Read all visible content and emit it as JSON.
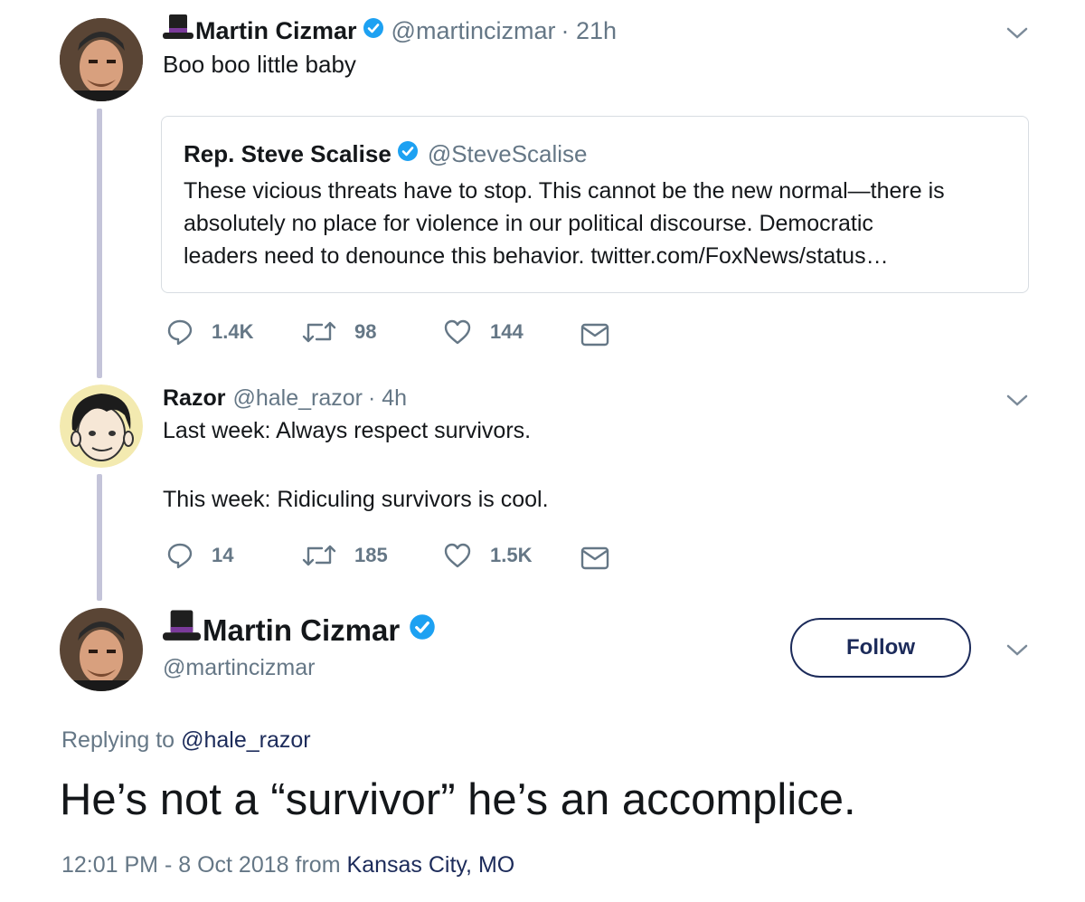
{
  "tweet1": {
    "name": "Martin Cizmar",
    "handle": "@martincizmar",
    "time": "· 21h",
    "text": "Boo boo little baby",
    "quote": {
      "name": "Rep. Steve Scalise",
      "handle": "@SteveScalise",
      "lines": [
        "These vicious threats have to stop. This cannot be the new normal—there is",
        "absolutely no place for violence in our political discourse. Democratic",
        "leaders need to denounce this behavior. twitter.com/FoxNews/status…"
      ]
    },
    "replies": "1.4K",
    "retweets": "98",
    "likes": "144"
  },
  "tweet2": {
    "name": "Razor",
    "handle": "@hale_razor",
    "time": "· 4h",
    "line1": "Last week: Always respect survivors.",
    "line2": "This week: Ridiculing survivors is cool.",
    "replies": "14",
    "retweets": "185",
    "likes": "1.5K"
  },
  "main": {
    "name": "Martin Cizmar",
    "handle": "@martincizmar",
    "follow_label": "Follow",
    "replying_prefix": "Replying to",
    "replying_to": "@hale_razor",
    "text": "He’s not a “survivor” he’s an accomplice.",
    "timestamp": "12:01 PM - 8 Oct 2018",
    "from_label": "from",
    "location": "Kansas City, MO"
  },
  "icons": {
    "verified": "verified-badge-icon",
    "reply": "reply-icon",
    "retweet": "retweet-icon",
    "like": "heart-icon",
    "dm": "envelope-icon",
    "caret": "chevron-down-icon",
    "emoji": "top-hat-emoji"
  },
  "colors": {
    "verified": "#1da1f2",
    "muted": "#657786",
    "text": "#14171a",
    "thread_line": "#c4c4d9",
    "follow_border": "#1c2b5a",
    "location_link": "#1c2b5a"
  }
}
